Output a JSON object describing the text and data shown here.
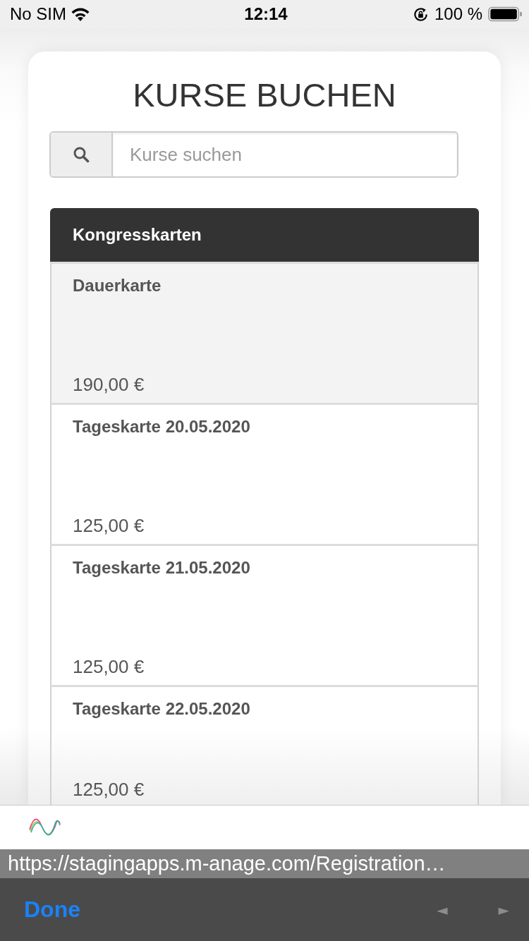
{
  "status_bar": {
    "carrier": "No SIM",
    "time": "12:14",
    "battery": "100 %"
  },
  "page": {
    "title": "KURSE BUCHEN",
    "search": {
      "placeholder": "Kurse suchen"
    }
  },
  "list": {
    "header": "Kongresskarten",
    "items": [
      {
        "title": "Dauerkarte",
        "price": "190,00 €",
        "selected": true
      },
      {
        "title": "Tageskarte 20.05.2020",
        "price": "125,00 €",
        "selected": false
      },
      {
        "title": "Tageskarte 21.05.2020",
        "price": "125,00 €",
        "selected": false
      },
      {
        "title": "Tageskarte 22.05.2020",
        "price": "125,00 €",
        "selected": false
      }
    ]
  },
  "browser": {
    "url": "https://stagingapps.m-anage.com/Registration…",
    "done": "Done",
    "nav": [
      {
        "label": "◄",
        "disabled": true
      },
      {
        "label": "►",
        "disabled": true
      }
    ]
  }
}
